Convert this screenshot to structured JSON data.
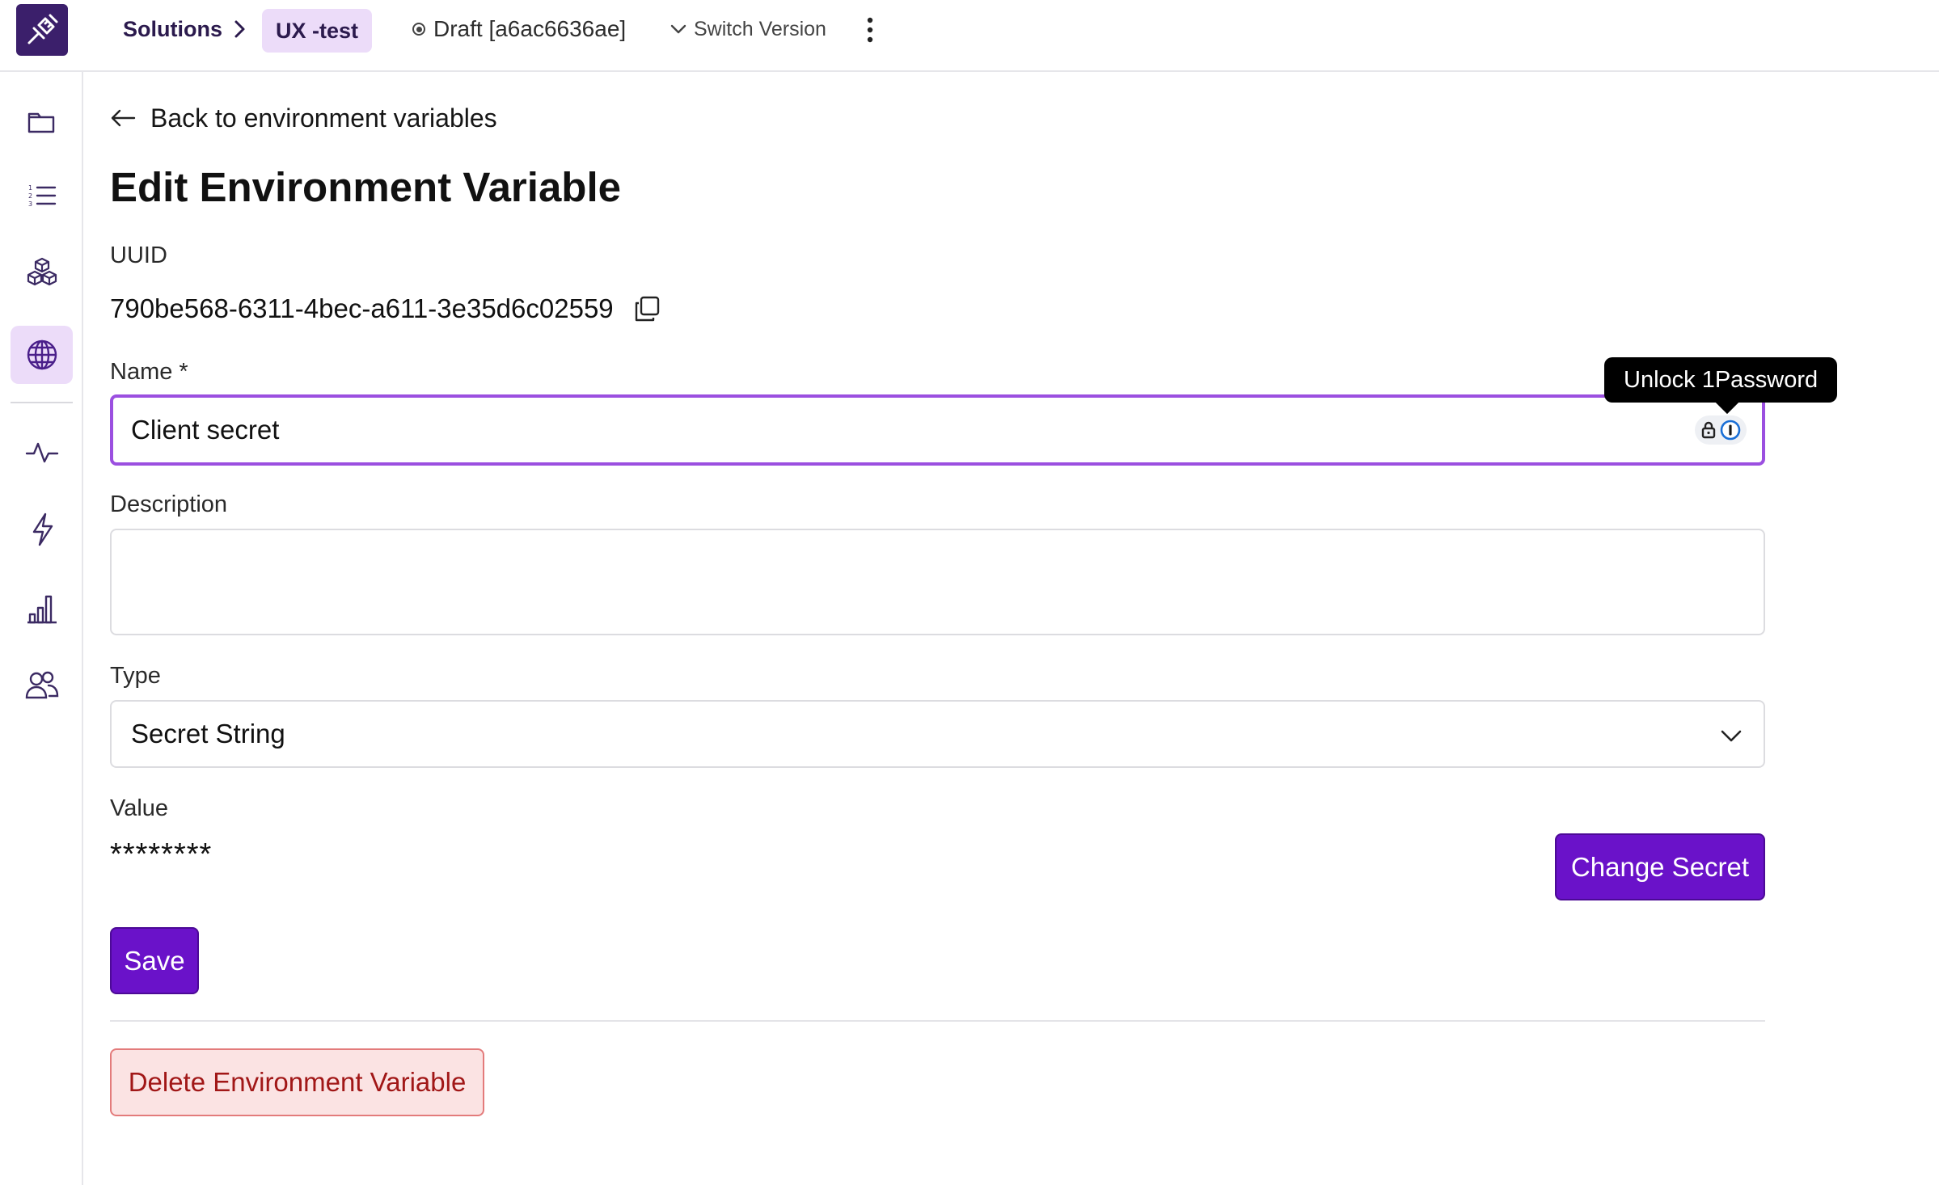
{
  "header": {
    "breadcrumb_root": "Solutions",
    "breadcrumb_current": "UX -test",
    "draft_label": "Draft [a6ac6636ae]",
    "switch_version_label": "Switch Version"
  },
  "sidebar": {
    "items": [
      {
        "icon": "folder-icon",
        "active": false
      },
      {
        "icon": "list-icon",
        "active": false
      },
      {
        "icon": "cubes-icon",
        "active": false
      },
      {
        "icon": "globe-icon",
        "active": true
      },
      {
        "icon": "activity-icon",
        "active": false
      },
      {
        "icon": "lightning-icon",
        "active": false
      },
      {
        "icon": "bar-chart-icon",
        "active": false
      },
      {
        "icon": "users-icon",
        "active": false
      }
    ]
  },
  "main": {
    "back_label": "Back to environment variables",
    "title": "Edit Environment Variable",
    "uuid_label": "UUID",
    "uuid_value": "790be568-6311-4bec-a611-3e35d6c02559",
    "name_label": "Name *",
    "name_value": "Client secret",
    "tooltip": "Unlock 1Password",
    "description_label": "Description",
    "description_value": "",
    "type_label": "Type",
    "type_value": "Secret String",
    "value_label": "Value",
    "value_masked": "********",
    "change_secret_label": "Change Secret",
    "save_label": "Save",
    "delete_label": "Delete Environment Variable"
  },
  "colors": {
    "accent": "#6a12c9",
    "focus_border": "#9b4fe0",
    "active_nav_bg": "#ecdcf9",
    "danger_text": "#a11717",
    "danger_bg": "#fbe3e3"
  }
}
